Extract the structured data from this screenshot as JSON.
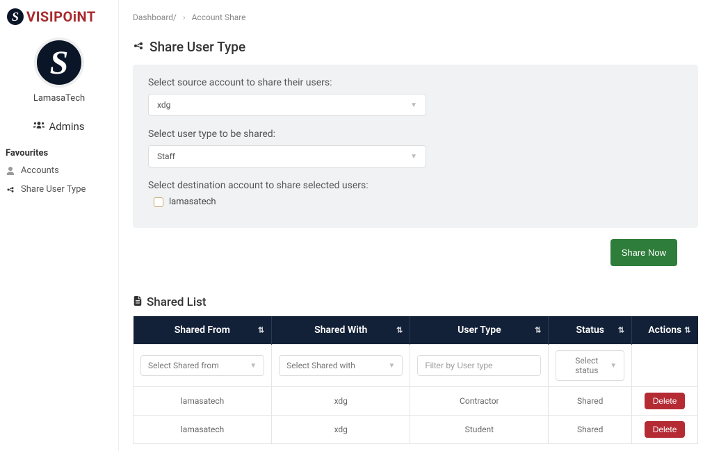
{
  "brand": {
    "name": "VISIPOiNT"
  },
  "org": {
    "name": "LamasaTech"
  },
  "sidebar": {
    "admins_label": "Admins",
    "section_label": "Favourites",
    "items": [
      {
        "label": "Accounts"
      },
      {
        "label": "Share User Type"
      }
    ]
  },
  "breadcrumb": {
    "root": "Dashboard/",
    "current": "Account Share"
  },
  "page": {
    "title": "Share User Type"
  },
  "form": {
    "source_label": "Select source account to share their users:",
    "source_value": "xdg",
    "usertype_label": "Select user type to be shared:",
    "usertype_value": "Staff",
    "dest_label": "Select destination account to share selected users:",
    "dest_checkbox_label": "lamasatech",
    "share_button": "Share Now"
  },
  "list": {
    "title": "Shared List",
    "headers": {
      "shared_from": "Shared From",
      "shared_with": "Shared With",
      "user_type": "User Type",
      "status": "Status",
      "actions": "Actions"
    },
    "filters": {
      "shared_from": "Select Shared from",
      "shared_with": "Select Shared with",
      "user_type_placeholder": "Filter by User type",
      "status": "Select status"
    },
    "rows": [
      {
        "shared_from": "lamasatech",
        "shared_with": "xdg",
        "user_type": "Contractor",
        "status": "Shared",
        "action": "Delete"
      },
      {
        "shared_from": "lamasatech",
        "shared_with": "xdg",
        "user_type": "Student",
        "status": "Shared",
        "action": "Delete"
      }
    ]
  }
}
